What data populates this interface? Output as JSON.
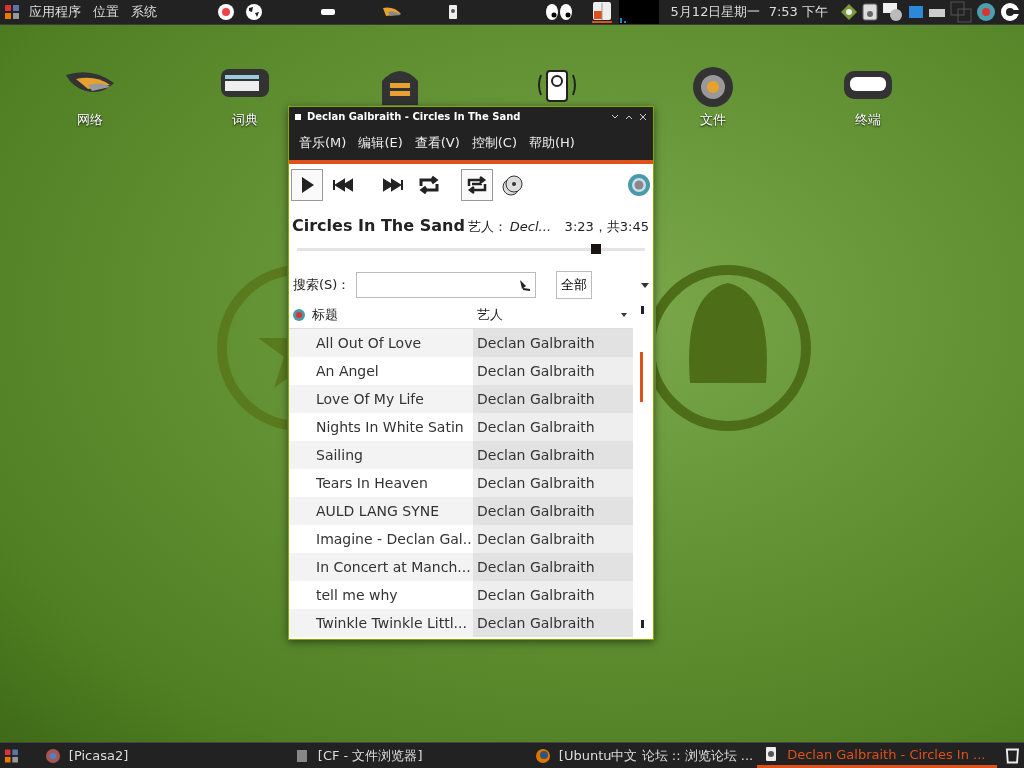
{
  "top_panel": {
    "menus": [
      "应用程序",
      "位置",
      "系统"
    ],
    "clock": "5月12日星期一  7:53 下午"
  },
  "desktop_icons": [
    {
      "kind": "network",
      "label": "网络"
    },
    {
      "kind": "dictionary",
      "label": "词典"
    },
    {
      "kind": "archive"
    },
    {
      "kind": "disk"
    },
    {
      "kind": "files",
      "label": "文件"
    },
    {
      "kind": "terminal",
      "label": "终端"
    }
  ],
  "window": {
    "title": "Declan Galbraith - Circles In The Sand",
    "menus": [
      "音乐(M)",
      "编辑(E)",
      "查看(V)",
      "控制(C)",
      "帮助(H)"
    ],
    "toolbar": [
      {
        "kind": "play",
        "pressed": true
      },
      {
        "kind": "previous",
        "pressed": false
      },
      {
        "kind": "next",
        "pressed": false
      },
      {
        "kind": "repeat",
        "pressed": false
      },
      {
        "kind": "shuffle",
        "pressed": true
      },
      {
        "kind": "cd",
        "pressed": false
      }
    ],
    "now_playing": {
      "title": "Circles In The Sand",
      "artist_label": "艺人：",
      "artist": "Decl...",
      "time": "3:23，共3:45",
      "level": 0.86
    },
    "search": {
      "label": "搜索(S)：",
      "filter": "全部"
    },
    "table": {
      "columns": [
        "标题",
        "艺人"
      ],
      "rows": [
        {
          "title": "All Out Of Love",
          "artist": "Declan Galbraith"
        },
        {
          "title": "An Angel",
          "artist": "Declan Galbraith"
        },
        {
          "title": "Love Of My Life",
          "artist": "Declan Galbraith"
        },
        {
          "title": "Nights In White Satin",
          "artist": "Declan Galbraith"
        },
        {
          "title": "Sailing",
          "artist": "Declan Galbraith"
        },
        {
          "title": "Tears In Heaven",
          "artist": "Declan Galbraith"
        },
        {
          "title": "AULD LANG SYNE",
          "artist": "Declan Galbraith"
        },
        {
          "title": "Imagine - Declan Gal...",
          "artist": "Declan Galbraith"
        },
        {
          "title": "In Concert at Manch...",
          "artist": "Declan Galbraith"
        },
        {
          "title": "tell me why",
          "artist": "Declan Galbraith"
        },
        {
          "title": "Twinkle Twinkle Littl...",
          "artist": "Declan Galbraith"
        }
      ]
    }
  },
  "taskbar": [
    {
      "label": "[Picasa2]",
      "selected": false
    },
    {
      "label": "[CF - 文件浏览器]",
      "selected": false
    },
    {
      "label": "[Ubuntu中文 论坛 :: 浏览论坛 ...",
      "selected": false
    },
    {
      "label": "Declan Galbraith - Circles In ...",
      "selected": true
    }
  ]
}
